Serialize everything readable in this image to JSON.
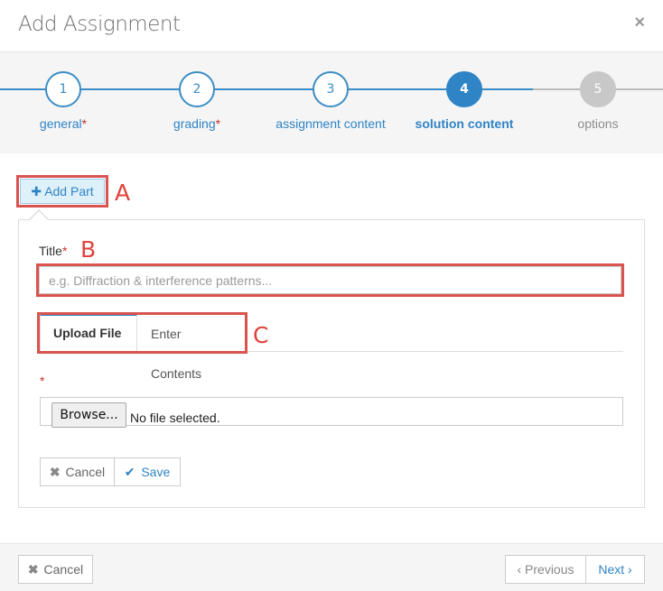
{
  "modal": {
    "title": "Add Assignment",
    "close_glyph": "×"
  },
  "wizard": {
    "steps": [
      {
        "number": "1",
        "label": "general",
        "required_mark": "*"
      },
      {
        "number": "2",
        "label": "grading",
        "required_mark": "*"
      },
      {
        "number": "3",
        "label": "assignment content",
        "required_mark": ""
      },
      {
        "number": "4",
        "label": "solution content",
        "required_mark": ""
      },
      {
        "number": "5",
        "label": "options",
        "required_mark": ""
      }
    ],
    "active_step": 4
  },
  "main": {
    "add_part": {
      "icon_glyph": "✚",
      "label": "Add Part"
    },
    "title_field": {
      "label": "Title",
      "required_mark": "*",
      "placeholder": "e.g. Diffraction & interference patterns...",
      "value": ""
    },
    "tabs": [
      {
        "label": "Upload File",
        "active": true
      },
      {
        "label": "Enter Contents",
        "active": false
      }
    ],
    "file_field": {
      "required_mark": "*",
      "browse_label": "Browse...",
      "status": "No file selected."
    },
    "part_actions": {
      "cancel_glyph": "✖",
      "cancel_label": "Cancel",
      "save_glyph": "✔",
      "save_label": "Save"
    }
  },
  "annotations": {
    "a": "A",
    "b": "B",
    "c": "C"
  },
  "footer": {
    "cancel_glyph": "✖",
    "cancel_label": "Cancel",
    "previous_label": "‹ Previous",
    "next_label": "Next ›"
  },
  "colors": {
    "accent": "#2f84c6",
    "highlight": "#d9534f",
    "required": "#c9302c"
  }
}
